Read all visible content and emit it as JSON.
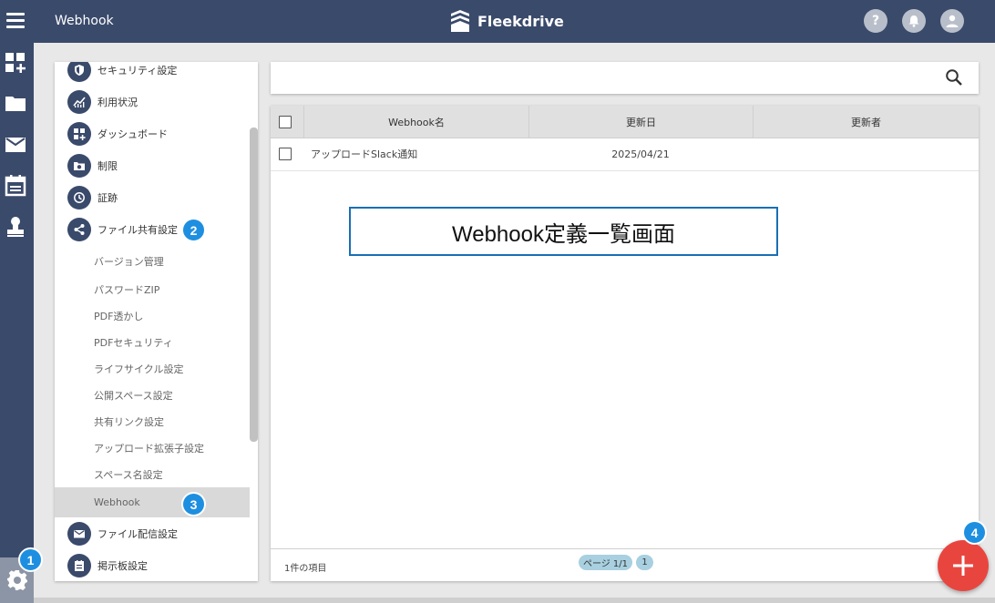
{
  "header": {
    "title": "Webhook",
    "brand": "Fleekdrive",
    "icons": [
      "menu-icon",
      "help-icon",
      "bell-icon",
      "user-icon"
    ],
    "help_glyph": "?"
  },
  "rail": {
    "icons": [
      "dashboard-add-icon",
      "folder-icon",
      "mail-icon",
      "calendar-icon",
      "stamp-icon",
      "gear-icon"
    ]
  },
  "menu": {
    "items": [
      {
        "label": "セキュリティ設定",
        "icon": "shield-icon"
      },
      {
        "label": "利用状況",
        "icon": "chart-icon"
      },
      {
        "label": "ダッシュボード",
        "icon": "dashboard-icon"
      },
      {
        "label": "制限",
        "icon": "limit-icon"
      },
      {
        "label": "証跡",
        "icon": "history-icon"
      },
      {
        "label": "ファイル共有設定",
        "icon": "share-icon"
      }
    ],
    "sub_items": [
      {
        "label": "バージョン管理"
      },
      {
        "label": "パスワードZIP"
      },
      {
        "label": "PDF透かし"
      },
      {
        "label": "PDFセキュリティ"
      },
      {
        "label": "ライフサイクル設定"
      },
      {
        "label": "公開スペース設定"
      },
      {
        "label": "共有リンク設定"
      },
      {
        "label": "アップロード拡張子設定"
      },
      {
        "label": "スペース名設定"
      },
      {
        "label": "Webhook"
      }
    ],
    "bottom_items": [
      {
        "label": "ファイル配信設定",
        "icon": "mail-icon"
      },
      {
        "label": "掲示板設定",
        "icon": "board-icon"
      }
    ]
  },
  "search": {
    "placeholder": ""
  },
  "table": {
    "columns": [
      "Webhook名",
      "更新日",
      "更新者"
    ],
    "rows": [
      {
        "name": "アップロードSlack通知",
        "updated": "2025/04/21",
        "updater": ""
      }
    ],
    "item_count": "1件の項目",
    "pagination": {
      "page_label": "ページ 1/1",
      "current": "1"
    }
  },
  "annotation": {
    "text": "Webhook定義一覧画面"
  },
  "badges": [
    "1",
    "2",
    "3",
    "4"
  ],
  "colors": {
    "header_bg": "#3a4a6b",
    "badge": "#1e8fe0",
    "fab": "#e9453f",
    "annotation_border": "#1a6fb5"
  }
}
